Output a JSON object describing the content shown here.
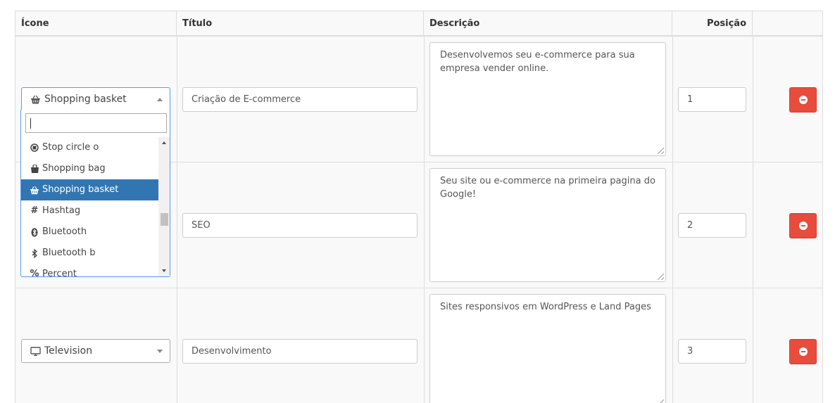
{
  "headers": {
    "icon": "Ícone",
    "title": "Título",
    "description": "Descrição",
    "position": "Posição"
  },
  "rows": [
    {
      "icon_label": "Shopping basket",
      "icon": "shopping-basket-icon",
      "title": "Criação de E-commerce",
      "description": "Desenvolvemos seu e-commerce para sua empresa vender online.",
      "position": "1"
    },
    {
      "icon_label": "",
      "icon": "",
      "title": "SEO",
      "description": "Seu site ou e-commerce na primeira pagina do Google!",
      "position": "2"
    },
    {
      "icon_label": "Television",
      "icon": "television-icon",
      "title": "Desenvolvimento",
      "description": "Sites responsivos em WordPress e Land Pages",
      "position": "3"
    }
  ],
  "dropdown": {
    "search_value": "",
    "options": [
      {
        "label": "Stop circle o",
        "icon": "stop-circle-icon"
      },
      {
        "label": "Shopping bag",
        "icon": "shopping-bag-icon"
      },
      {
        "label": "Shopping basket",
        "icon": "shopping-basket-icon",
        "selected": true
      },
      {
        "label": "Hashtag",
        "icon": "hashtag-icon"
      },
      {
        "label": "Bluetooth",
        "icon": "bluetooth-icon"
      },
      {
        "label": "Bluetooth b",
        "icon": "bluetooth-b-icon"
      },
      {
        "label": "Percent",
        "icon": "percent-icon"
      }
    ]
  },
  "colors": {
    "delete_button": "#e74c3c",
    "selected_option": "#3276b1",
    "focus_border": "#5897fb"
  }
}
